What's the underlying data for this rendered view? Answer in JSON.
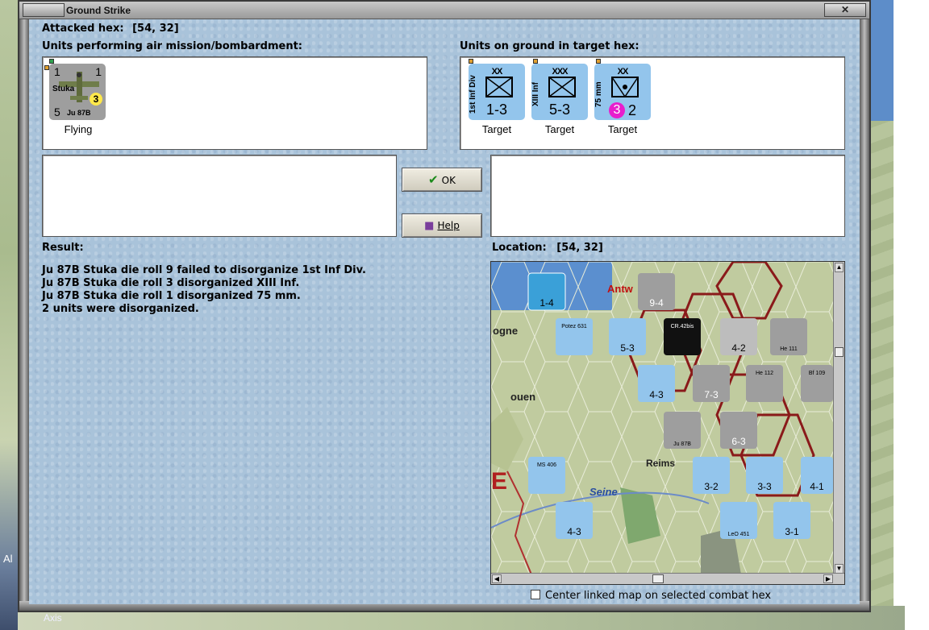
{
  "window": {
    "title": "Ground Strike",
    "close_glyph": "✕"
  },
  "attacked_hex": {
    "label": "Attacked hex:",
    "value": "[54, 32]"
  },
  "air_units": {
    "label": "Units performing air mission/bombardment:",
    "units": [
      {
        "name": "Stuka",
        "type": "Ju 87B",
        "top_left": "1",
        "top_right": "1",
        "bottom_left": "5",
        "badge": "3",
        "status": "Flying"
      }
    ]
  },
  "ground_units": {
    "label": "Units on ground in target hex:",
    "units": [
      {
        "side_label": "1st Inf Div",
        "size": "XX",
        "value": "1-3",
        "status": "Target"
      },
      {
        "side_label": "XIII Inf",
        "size": "XXX",
        "value": "5-3",
        "status": "Target"
      },
      {
        "side_label": "75 mm",
        "size": "XX",
        "value_badge": "3",
        "value_rest": "2",
        "status": "Target"
      }
    ]
  },
  "buttons": {
    "ok": "OK",
    "help": "Help"
  },
  "result": {
    "label": "Result:",
    "lines": [
      "Ju 87B Stuka die roll 9 failed to disorganize 1st Inf Div.",
      "Ju 87B Stuka die roll 3 disorganized XIII Inf.",
      "Ju 87B Stuka die roll 1 disorganized 75 mm.",
      "2 units were disorganized."
    ]
  },
  "location": {
    "label": "Location:",
    "value": "[54, 32]"
  },
  "minimap": {
    "place_labels": [
      "Antw",
      "ogne",
      "ouen",
      "Reims",
      "Seine",
      "E"
    ],
    "counters": [
      {
        "label": "1-4"
      },
      {
        "label": "9-4"
      },
      {
        "label": "Potez 631"
      },
      {
        "label": "5-3"
      },
      {
        "label": "CR.42bis"
      },
      {
        "label": "4-2"
      },
      {
        "label": "He 111"
      },
      {
        "label": "4-3"
      },
      {
        "label": "7-3"
      },
      {
        "label": "He 112"
      },
      {
        "label": "Bf 109"
      },
      {
        "label": "Ju 87B"
      },
      {
        "label": "6-3"
      },
      {
        "label": "MS 406"
      },
      {
        "label": "3-2"
      },
      {
        "label": "3-3"
      },
      {
        "label": "4-1"
      },
      {
        "label": "4-3"
      },
      {
        "label": "LeO 451"
      },
      {
        "label": "3-1"
      }
    ]
  },
  "center_checkbox": {
    "label": "Center linked map on selected combat hex",
    "checked": false
  },
  "background": {
    "left_text": "Al",
    "bottom_text": "Axis"
  },
  "colors": {
    "panel": "#a9c3da",
    "counter_blue": "#93c5ec",
    "counter_grey": "#9e9e9e",
    "hex_border": "#8a1a1a"
  }
}
